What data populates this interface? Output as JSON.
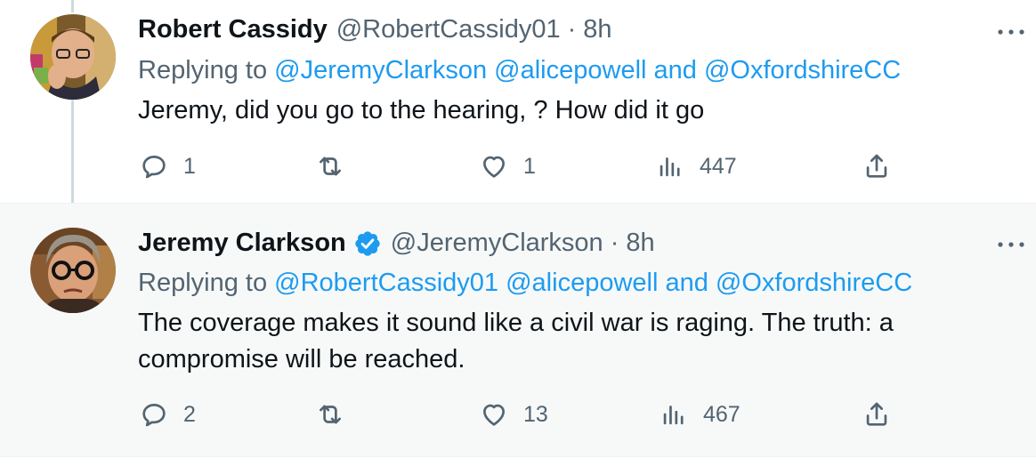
{
  "tweets": [
    {
      "author": "Robert Cassidy",
      "handle": "@RobertCassidy01",
      "separator": "·",
      "time": "8h",
      "verified": false,
      "replying_prefix": "Replying to",
      "mention_1": "@JeremyClarkson",
      "mention_2": "@alicepowell",
      "and_word": "and",
      "mention_3": "@OxfordshireCC",
      "text": "Jeremy, did you go to the hearing, ? How did it go",
      "replies": "1",
      "retweets": "",
      "likes": "1",
      "views": "447"
    },
    {
      "author": "Jeremy Clarkson",
      "handle": "@JeremyClarkson",
      "separator": "·",
      "time": "8h",
      "verified": true,
      "replying_prefix": "Replying to",
      "mention_1": "@RobertCassidy01",
      "mention_2": "@alicepowell",
      "and_word": "and",
      "mention_3": "@OxfordshireCC",
      "text": "The coverage makes it sound like a civil war is raging. The truth: a compromise will be reached.",
      "replies": "2",
      "retweets": "",
      "likes": "13",
      "views": "467"
    }
  ],
  "icons": {
    "reply": "reply-icon",
    "retweet": "retweet-icon",
    "like": "heart-icon",
    "views": "views-icon",
    "share": "share-icon",
    "more": "more-icon",
    "verified": "verified-badge-icon"
  },
  "colors": {
    "accent": "#1d9bf0",
    "muted": "#536471",
    "text": "#0f1419",
    "highlight_bg": "#f7f9f9",
    "thread_line": "#cfd9de"
  }
}
